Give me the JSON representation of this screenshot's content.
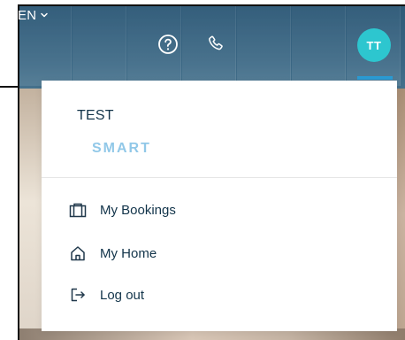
{
  "header": {
    "language": "EN",
    "avatar_initials": "TT",
    "icons": {
      "help": "help-icon",
      "phone": "phone-icon",
      "chevron": "chevron-down-icon"
    }
  },
  "menu": {
    "user_name": "TEST",
    "user_tier": "SMART",
    "items": [
      {
        "label": "My Bookings",
        "icon": "briefcase-icon"
      },
      {
        "label": "My Home",
        "icon": "home-icon"
      },
      {
        "label": "Log out",
        "icon": "logout-icon"
      }
    ]
  }
}
